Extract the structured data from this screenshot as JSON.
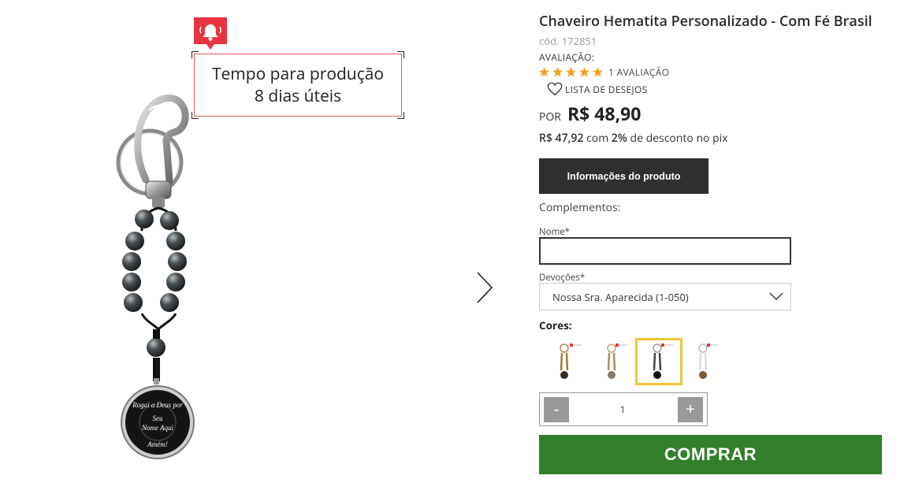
{
  "product": {
    "title": "Chaveiro Hematita Personalizado - Com Fé Brasil",
    "code": "cód. 172851",
    "rating_label": "AVALIAÇÃO:",
    "rating_stars": 5,
    "rating_count": "1 AVALIAÇÃO",
    "wishlist": "LISTA DE DESEJOS",
    "price_prefix": "POR",
    "price": "R$ 48,90",
    "pix_price": "R$ 47,92",
    "pix_with": "com",
    "pix_percent": "2%",
    "pix_suffix": "de desconto no pix"
  },
  "production_badge": {
    "line1": "Tempo para produção",
    "line2": "8 dias úteis",
    "icon": "alarm-bell-icon"
  },
  "pendant_text": {
    "top": "Rogai a Deus por",
    "middle1": "Seu",
    "middle2": "Nome Aqui",
    "bottom": "Amém!"
  },
  "buttons": {
    "info": "Informações do produto",
    "buy": "COMPRAR",
    "minus": "-",
    "plus": "+"
  },
  "form": {
    "complements_label": "Complementos:",
    "name_label": "Nome*",
    "name_value": "",
    "devotion_label": "Devoções*",
    "devotion_value": "Nossa Sra. Aparecida (1-050)",
    "colors_label": "Cores:",
    "quantity": "1"
  },
  "colors": {
    "accent_green": "#337e2a",
    "selected_border": "#f2c33a",
    "badge_red": "#e8343e",
    "star": "#f0a020"
  }
}
